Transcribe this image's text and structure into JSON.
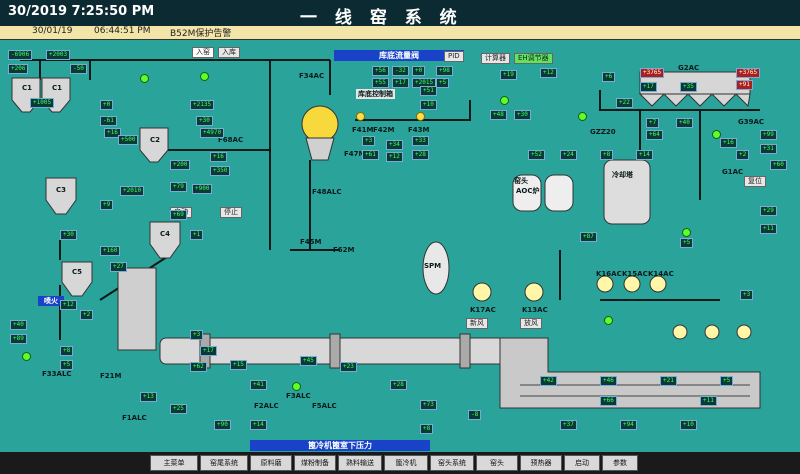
{
  "header": {
    "datetime": "30/2019 7:25:50 PM",
    "title": "一 线 窑 系 统"
  },
  "alarm": {
    "date": "30/01/19",
    "time": "06:44:51 PM",
    "message": "B52M保护告警"
  },
  "flow_panel": {
    "title": "库底流量阀",
    "pid": "PID",
    "btn_calc": "计算器",
    "btn_dispatch": "EH调节器",
    "sub": "库底控制箱"
  },
  "labels": {
    "c1": "C1",
    "c2": "C2",
    "c3": "C3",
    "c4": "C4",
    "c5": "C5",
    "f34ac": "F34AC",
    "f68ac": "F68AC",
    "f41m": "F41M",
    "f42m": "F42M",
    "f43m": "F43M",
    "f47m": "F47M",
    "f48alc": "F48ALC",
    "f45m": "F45M",
    "f62m": "F62M",
    "g2ac": "G2AC",
    "g39ac": "G39AC",
    "g1ac": "G1AC",
    "gzz20": "GZZ20",
    "k16ac": "K16AC",
    "k15ac": "K15AC",
    "k14ac": "K14AC",
    "k17ac": "K17AC",
    "k13ac": "K13AC",
    "aoc": "AOC炉",
    "cool": "冷却塔",
    "cooler": "篦冷机",
    "f33alc": "F33ALC",
    "f21m": "F21M",
    "f2alc": "F2ALC",
    "f1alc": "F1ALC",
    "f3alc": "F3ALC",
    "f5alc": "F5ALC",
    "spm": "SPM",
    "kiln_head": "窑头",
    "fire": "喷火",
    "cooler_bar": "篦冷机篦室下压力"
  },
  "buttons": {
    "auto": "入窑",
    "manual": "入库",
    "start": "启动",
    "stop": "停止",
    "reset": "复位",
    "fan": "新风",
    "vent": "放风"
  },
  "nav": [
    "主菜单",
    "窑尾系统",
    "原料磨",
    "煤粉制备",
    "熟料输送",
    "篦冷机",
    "窑头系统",
    "窑头",
    "预热器",
    "启动",
    "参数"
  ],
  "readings": [
    "-6906",
    "+2003",
    "+206",
    "-50",
    "+1005",
    "+0",
    "-61",
    "+16",
    "+500",
    "+2135",
    "+30",
    "+4970",
    "+200",
    "+16",
    "+350",
    "+79",
    "+900",
    "+2010",
    "+9",
    "+69",
    "+1",
    "+30",
    "+160",
    "+27",
    "+12",
    "+2",
    "+40",
    "+89",
    "+8",
    "+5",
    "+3",
    "+17",
    "+62",
    "+15",
    "+41",
    "+13",
    "+25",
    "+90",
    "+14",
    "+45",
    "+23",
    "+28",
    "+73",
    "-8",
    "+8",
    "+42",
    "+46",
    "+21",
    "+5",
    "+66",
    "+11",
    "+37",
    "+94",
    "+10",
    "+56",
    "-32",
    "+0",
    "+98",
    "+55",
    "+17",
    "+2015",
    "+5",
    "+3",
    "+34",
    "+33",
    "+61",
    "+12",
    "+28",
    "+10",
    "+51",
    "+19",
    "+12",
    "+48",
    "+30",
    "+6",
    "+17",
    "+35",
    "+22",
    "+7",
    "+64",
    "+40",
    "+16",
    "+2",
    "+99",
    "+31",
    "+60",
    "+8",
    "+14",
    "+52",
    "+24",
    "+87",
    "+5",
    "+29",
    "+11",
    "+3",
    "+47"
  ],
  "alerts": [
    "+3765",
    "+3765",
    "+91"
  ],
  "colors": {
    "background": "#2aa39a",
    "topbar": "#0c2a32",
    "panel_header": "#1a42c8",
    "value": "#3fff6a",
    "alarm": "#ad1f1f"
  }
}
